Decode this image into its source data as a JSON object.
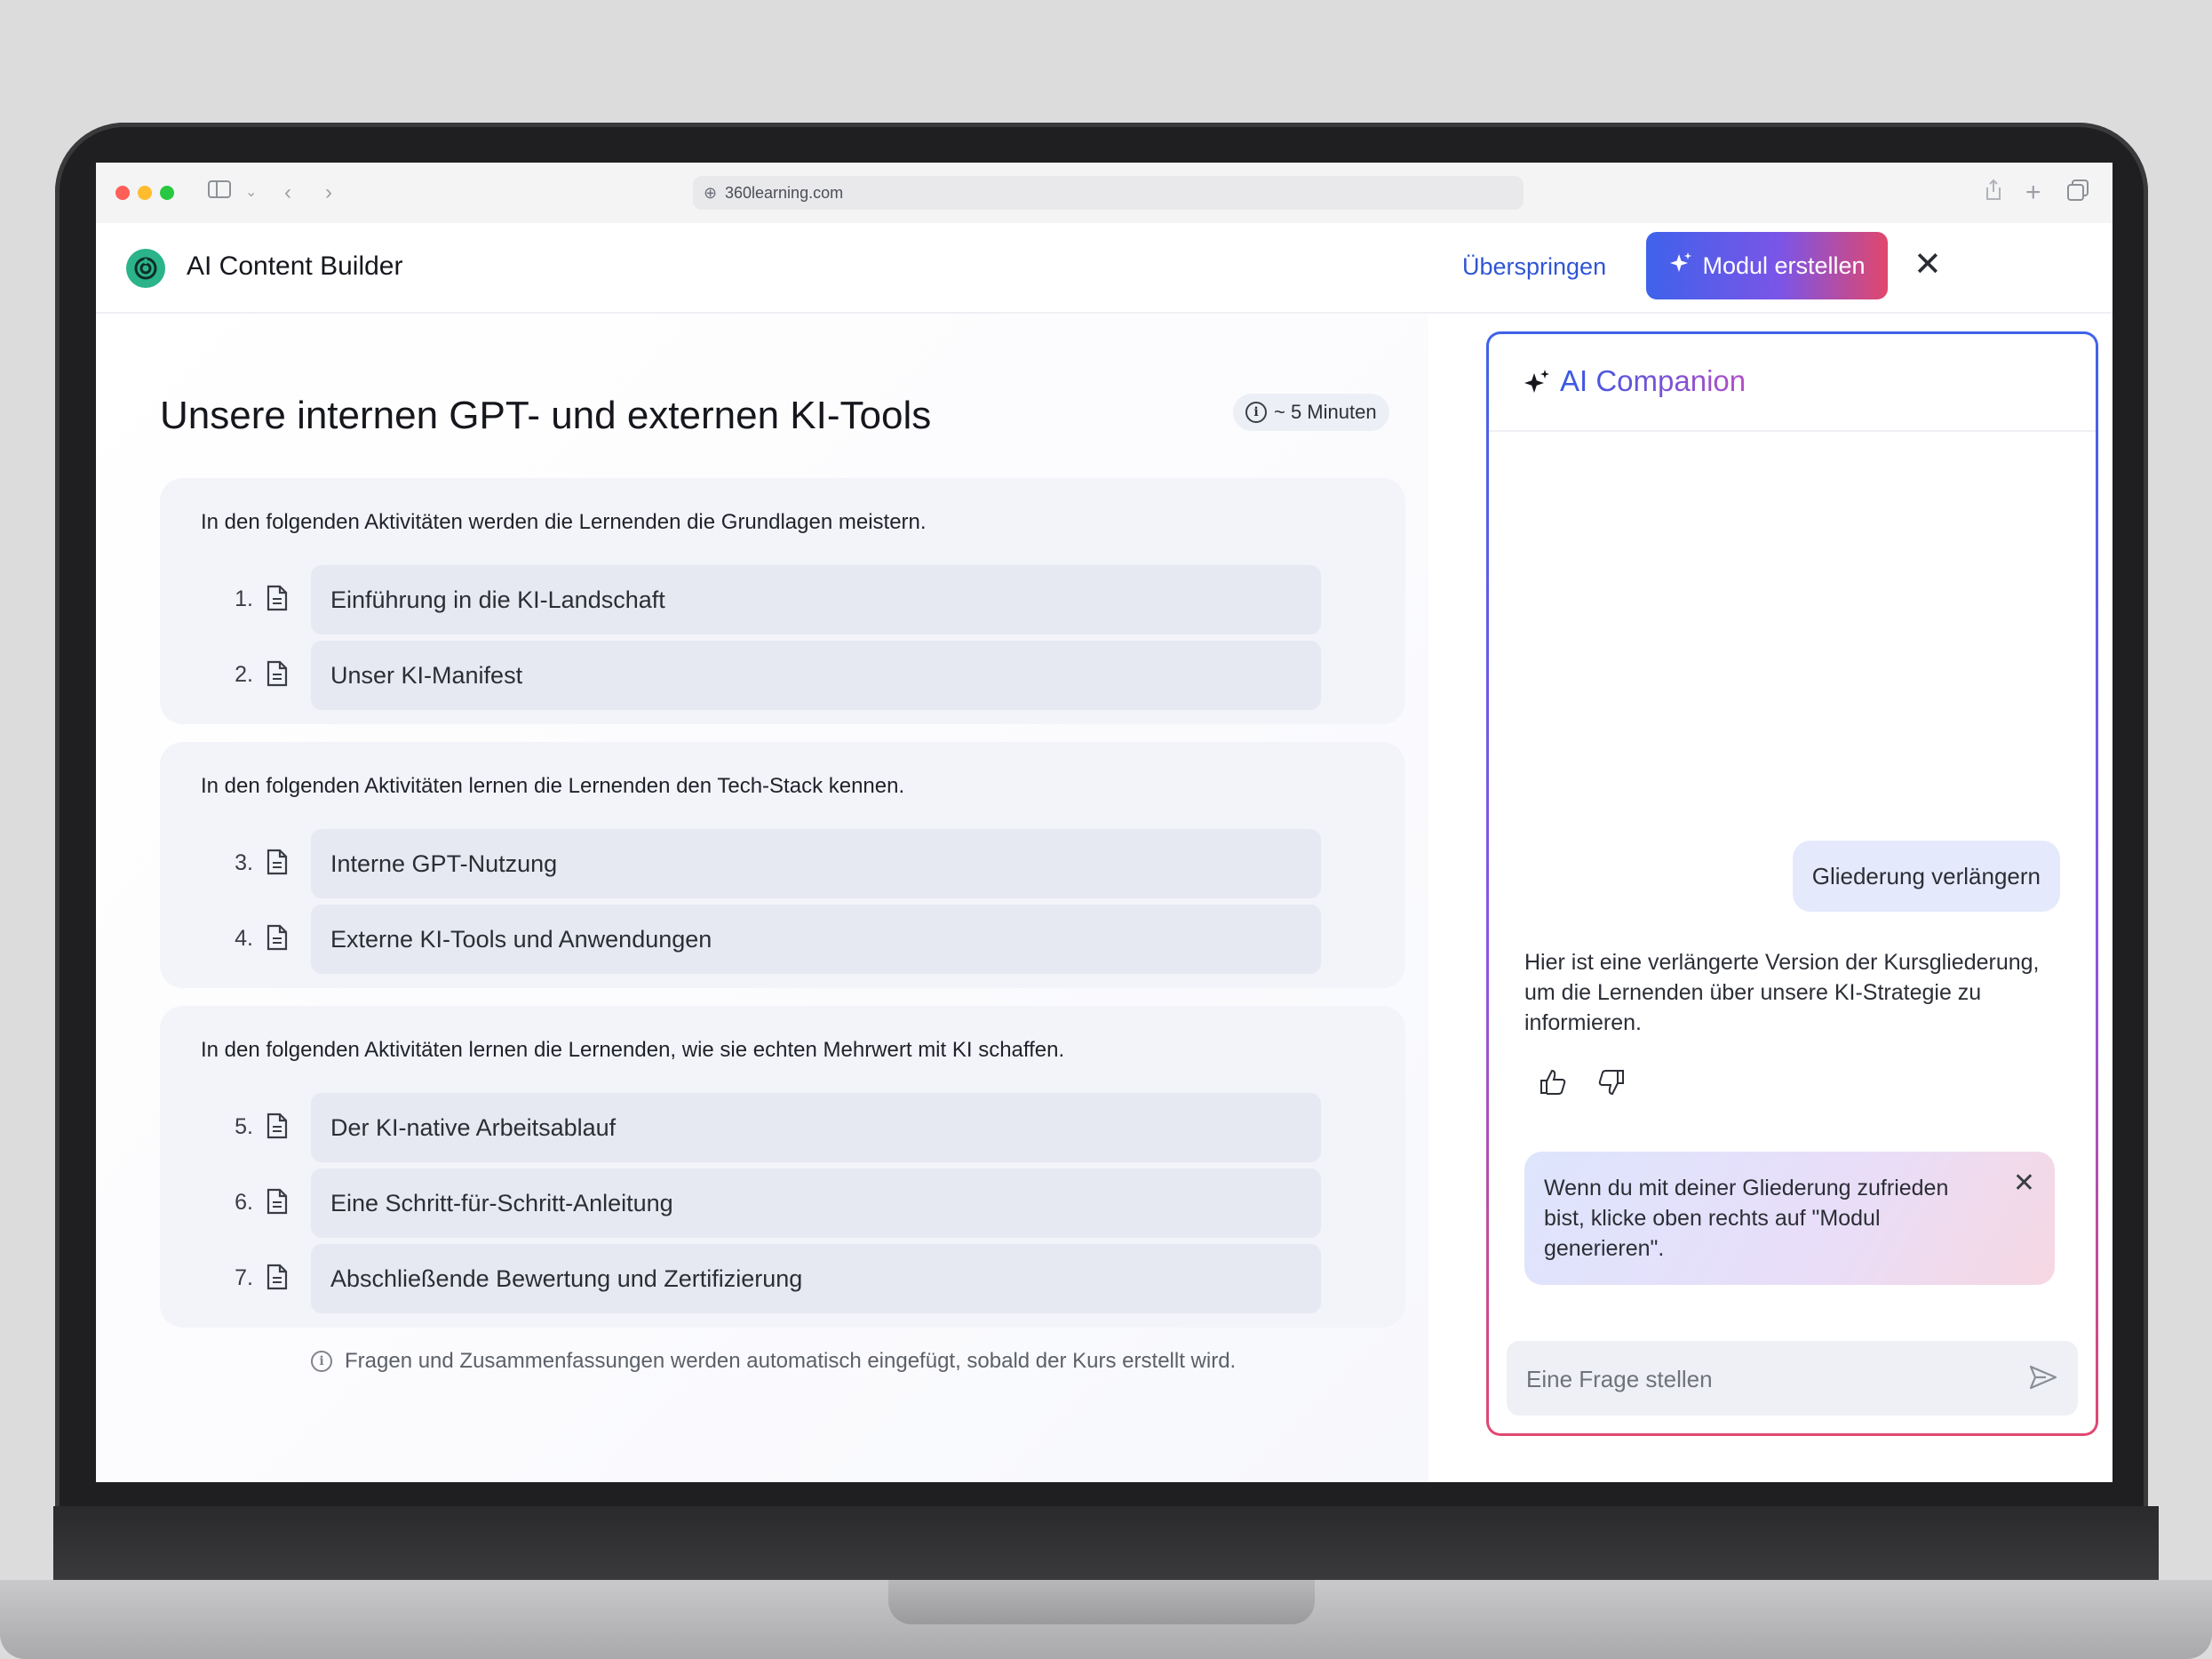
{
  "browser": {
    "url": "360learning.com"
  },
  "header": {
    "app_title": "AI Content Builder",
    "skip_label": "Überspringen",
    "create_label": "Modul erstellen"
  },
  "module": {
    "title": "Unsere internen GPT- und externen KI-Tools",
    "duration": "~ 5 Minuten",
    "sections": [
      {
        "intro": "In den folgenden Aktivitäten werden die Lernenden die Grundlagen meistern.",
        "activities": [
          {
            "num": "1.",
            "title": "Einführung in die KI-Landschaft"
          },
          {
            "num": "2.",
            "title": "Unser KI-Manifest"
          }
        ]
      },
      {
        "intro": "In den folgenden Aktivitäten lernen die Lernenden den Tech-Stack kennen.",
        "activities": [
          {
            "num": "3.",
            "title": "Interne GPT-Nutzung"
          },
          {
            "num": "4.",
            "title": "Externe KI-Tools und Anwendungen"
          }
        ]
      },
      {
        "intro": "In den folgenden Aktivitäten lernen die Lernenden, wie sie echten Mehrwert mit KI schaffen.",
        "activities": [
          {
            "num": "5.",
            "title": "Der KI-native Arbeitsablauf"
          },
          {
            "num": "6.",
            "title": "Eine Schritt-für-Schritt-Anleitung"
          },
          {
            "num": "7.",
            "title": "Abschließende Bewertung und Zertifizierung"
          }
        ]
      }
    ],
    "footnote": "Fragen und Zusammenfassungen werden automatisch eingefügt, sobald der Kurs erstellt wird."
  },
  "companion": {
    "title": "AI Companion",
    "user_message": "Gliederung verlängern",
    "ai_reply": "Hier ist eine verlängerte Version der Kursgliederung, um die Lernenden über unsere KI-Strategie zu informieren.",
    "hint": "Wenn du mit deiner Gliederung zufrieden bist, klicke oben rechts auf \"Modul generieren\".",
    "input_placeholder": "Eine Frage stellen"
  },
  "colors": {
    "accent_blue": "#2f55d4",
    "gradient_start": "#3f62ea",
    "gradient_end": "#e1476c",
    "logo_green": "#2bb38a"
  }
}
